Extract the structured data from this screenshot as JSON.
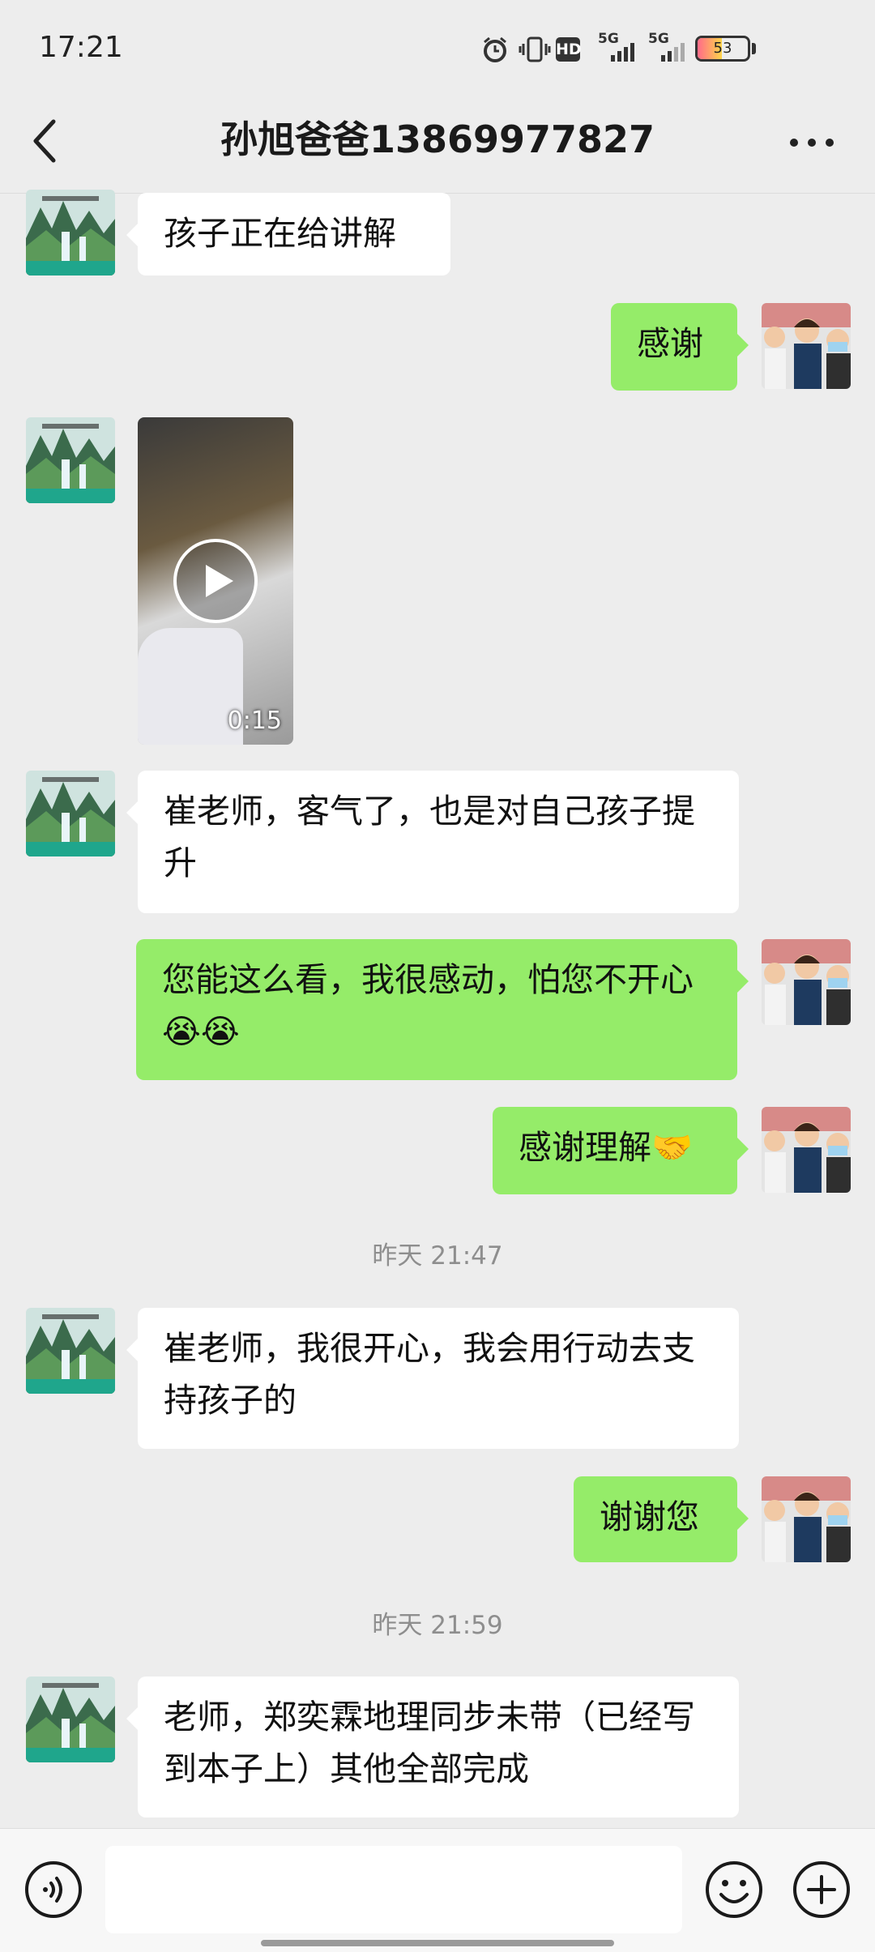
{
  "status_bar": {
    "time": "17:21",
    "icons": [
      "alarm-icon",
      "vibrate-icon",
      "hd-icon",
      "signal-5g-icon",
      "signal-5g-icon-2",
      "battery-icon"
    ],
    "net_label_1": "5G",
    "net_label_2": "5G",
    "hd_label": "HD",
    "battery": "53"
  },
  "header": {
    "title": "孙旭爸爸13869977827",
    "back_icon": "back-chevron-icon",
    "more_icon": "more-dots-icon"
  },
  "messages": [
    {
      "side": "in",
      "type": "text",
      "text": "孩子正在给讲解"
    },
    {
      "side": "out",
      "type": "text",
      "text": "感谢"
    },
    {
      "side": "in",
      "type": "video",
      "duration": "0:15"
    },
    {
      "side": "in",
      "type": "text",
      "text": "崔老师，客气了，也是对自己孩子提升"
    },
    {
      "side": "out",
      "type": "text",
      "text": "您能这么看，我很感动，怕您不开心😭😭"
    },
    {
      "side": "out",
      "type": "text",
      "text": "感谢理解🤝"
    },
    {
      "type": "timestamp",
      "text": "昨天 21:47"
    },
    {
      "side": "in",
      "type": "text",
      "text": "崔老师，我很开心，我会用行动去支持孩子的"
    },
    {
      "side": "out",
      "type": "text",
      "text": "谢谢您"
    },
    {
      "type": "timestamp",
      "text": "昨天 21:59"
    },
    {
      "side": "in",
      "type": "text",
      "text": "老师，郑奕霖地理同步未带（已经写到本子上）其他全部完成"
    }
  ],
  "input_bar": {
    "voice_icon": "voice-icon",
    "emoji_icon": "emoji-icon",
    "plus_icon": "plus-icon",
    "input_value": ""
  },
  "colors": {
    "background": "#ededed",
    "outgoing_bubble": "#95ec69",
    "incoming_bubble": "#ffffff"
  }
}
